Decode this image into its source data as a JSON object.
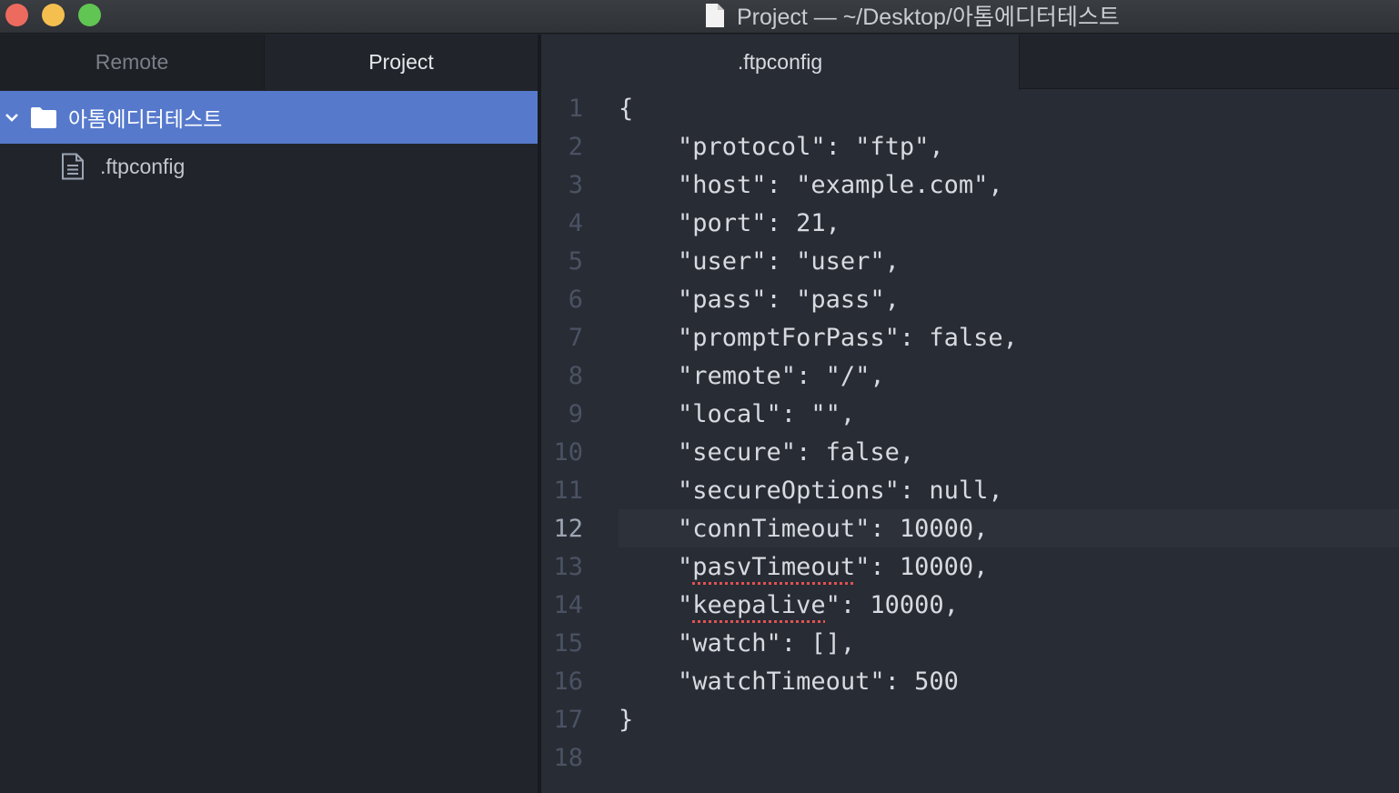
{
  "window": {
    "title": "Project — ~/Desktop/아톰에디터테스트",
    "traffic_lights": {
      "close": "#ed6a5e",
      "minimize": "#f4bf4f",
      "maximize": "#61c554"
    }
  },
  "sidebar": {
    "tabs": [
      {
        "label": "Remote",
        "active": false
      },
      {
        "label": "Project",
        "active": true
      }
    ],
    "tree": {
      "root": {
        "label": "아톰에디터테스트",
        "expanded": true,
        "icon": "folder-icon"
      },
      "files": [
        {
          "label": ".ftpconfig",
          "icon": "file-text-icon"
        }
      ]
    },
    "selection_color": "#5679cc"
  },
  "editor": {
    "active_tab": ".ftpconfig",
    "current_line": 12,
    "lines": [
      {
        "num": "1",
        "text": "{"
      },
      {
        "num": "2",
        "text": "    \"protocol\": \"ftp\","
      },
      {
        "num": "3",
        "text": "    \"host\": \"example.com\","
      },
      {
        "num": "4",
        "text": "    \"port\": 21,"
      },
      {
        "num": "5",
        "text": "    \"user\": \"user\","
      },
      {
        "num": "6",
        "text": "    \"pass\": \"pass\","
      },
      {
        "num": "7",
        "text": "    \"promptForPass\": false,"
      },
      {
        "num": "8",
        "text": "    \"remote\": \"/\","
      },
      {
        "num": "9",
        "text": "    \"local\": \"\","
      },
      {
        "num": "10",
        "text": "    \"secure\": false,"
      },
      {
        "num": "11",
        "text": "    \"secureOptions\": null,"
      },
      {
        "num": "12",
        "text": "    \"connTimeout\": 10000,"
      },
      {
        "num": "13",
        "pre": "    \"",
        "spell": "pasvTimeout",
        "post": "\": 10000,"
      },
      {
        "num": "14",
        "pre": "    \"",
        "spell": "keepalive",
        "post": "\": 10000,"
      },
      {
        "num": "15",
        "text": "    \"watch\": [],"
      },
      {
        "num": "16",
        "text": "    \"watchTimeout\": 500"
      },
      {
        "num": "17",
        "text": "}"
      },
      {
        "num": "18",
        "text": ""
      }
    ]
  }
}
